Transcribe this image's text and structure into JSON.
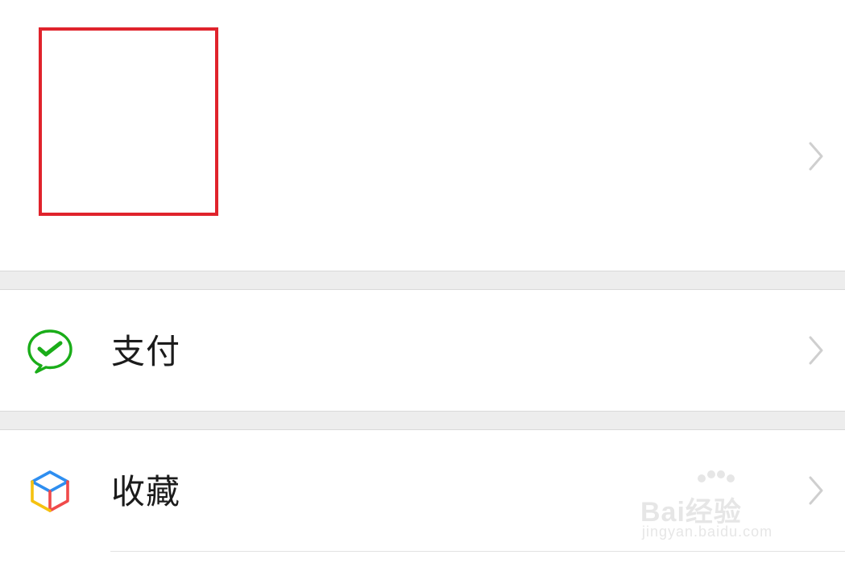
{
  "profile": {
    "chevron_icon": "chevron-right-icon"
  },
  "menu": {
    "items": [
      {
        "label": "支付",
        "icon": "wechat-pay-icon",
        "icon_color": "#1aad19"
      },
      {
        "label": "收藏",
        "icon": "favorites-cube-icon",
        "icon_colors": [
          "#2e8ef0",
          "#f04a4a",
          "#f5c10f"
        ]
      }
    ]
  },
  "watermark": {
    "brand": "Bai经验",
    "url": "jingyan.baidu.com"
  },
  "colors": {
    "highlight_border": "#e0232c",
    "section_gap": "#ededed",
    "text": "#1b1b1b",
    "chevron": "#cfcfcf"
  }
}
